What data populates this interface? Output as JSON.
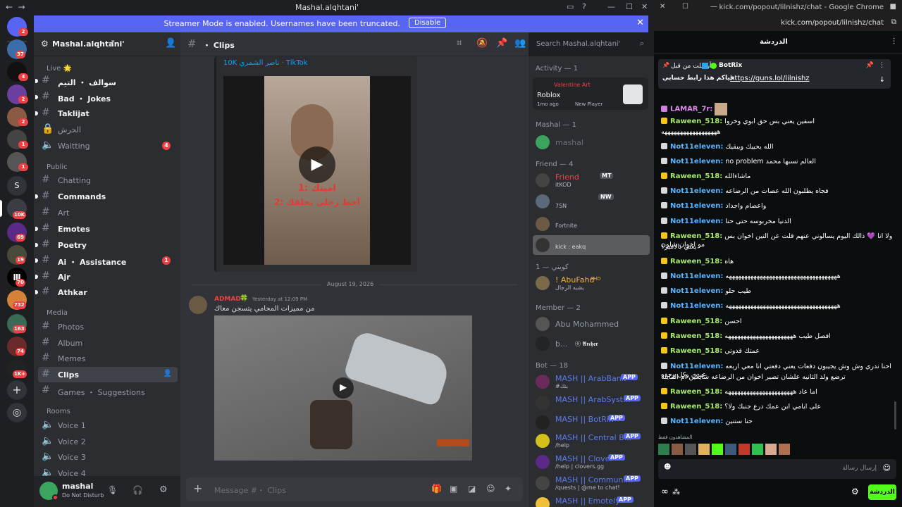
{
  "titlebar": {
    "title": "Mashal.alqhtani'"
  },
  "banner": {
    "message": "Streamer Mode is enabled. Usernames have been truncated.",
    "disable_label": "Disable"
  },
  "servers": [
    {
      "badge": "2"
    },
    {
      "badge": "37"
    },
    {
      "badge": "4"
    },
    {
      "badge": "2"
    },
    {
      "badge": "2"
    },
    {
      "badge": "1"
    },
    {
      "badge": "1"
    },
    {
      "letter": "S",
      "badge": ""
    },
    {
      "badge": "10K"
    },
    {
      "badge": "69"
    },
    {
      "badge": "19"
    },
    {
      "badge": "70"
    },
    {
      "badge": "732"
    },
    {
      "badge": "163"
    },
    {
      "badge": "74"
    },
    {
      "badge": "1K+"
    }
  ],
  "guild": {
    "name": "Mashal.alqhtani'"
  },
  "categories": {
    "live": "Live 🌟",
    "public": "Public",
    "media": "Media",
    "rooms": "Rooms"
  },
  "channels": [
    {
      "label": "سوالف ・ التيم"
    },
    {
      "label": "Bad ・ Jokes"
    },
    {
      "label": "Taklijat"
    },
    {
      "label": "الحرش"
    },
    {
      "label": "Waitting",
      "badge": "4"
    },
    {
      "label": "Chatting"
    },
    {
      "label": "Commands"
    },
    {
      "label": "Art"
    },
    {
      "label": "Emotes"
    },
    {
      "label": "Poetry"
    },
    {
      "label": "Ai ・ Assistance",
      "badge": "1"
    },
    {
      "label": "Ajr"
    },
    {
      "label": "Athkar"
    },
    {
      "label": "Photos"
    },
    {
      "label": "Album"
    },
    {
      "label": "Memes"
    },
    {
      "label": "Clips"
    },
    {
      "label": "Games ・ Suggestions"
    },
    {
      "label": "Voice 1"
    },
    {
      "label": "Voice 2"
    },
    {
      "label": "Voice 3"
    },
    {
      "label": "Voice 4"
    }
  ],
  "user": {
    "name": "mashal",
    "status": "Do Not Disturb"
  },
  "chat": {
    "channel": "・ Clips",
    "embed_link": "10K ناصر الشمري · TikTok",
    "video_caption_1": "1: اميتك",
    "video_caption_2": "2: أحط رجلي بحلقك",
    "date_divider": "August 19, 2026",
    "msg_author": "ADMAD",
    "msg_time": "Yesterday at 12:09 PM",
    "msg_text": "من مميزات المحامي يتسجن معاك",
    "input_placeholder": "Message #・ Clips"
  },
  "search": {
    "placeholder": "Search Mashal.alqhtani'"
  },
  "members": {
    "activity_head": "Activity — 1",
    "activity_user": "Valentine Art",
    "activity_game": "Roblox",
    "activity_time": "1mo ago",
    "activity_player": "New Player",
    "mashal_head": "Mashal — 1",
    "mashal_name": "mashal",
    "friend_head": "Friend — 4",
    "f1_name": "Friend",
    "f1_tag": "MT",
    "f1_status": "itKOD",
    "f2_tag": "NW",
    "f2_status": "7SN",
    "f3_status": "Fortnite",
    "f4_status": "kick : eakq",
    "k_head": "كويتي — 1",
    "k_name": "! AbuFahd",
    "k_tag": "FHD",
    "k_status": "يشبه الرجال",
    "member_head": "Member — 2",
    "m1_name": "Abu Mohammed",
    "m2_name": "b...",
    "m2_tag": "ⓞ 𝕬𝖗𝖈𝖍𝖊𝖗",
    "bot_head": "Bot — 18",
    "bots": [
      {
        "name": "MASH || ArabBank",
        "status": "#بنك"
      },
      {
        "name": "MASH || ArabSyst...",
        "status": ""
      },
      {
        "name": "MASH || BotRix",
        "status": ""
      },
      {
        "name": "MASH || Central B...",
        "status": "/help"
      },
      {
        "name": "MASH || Clover",
        "status": "/help | clovers.gg"
      },
      {
        "name": "MASH || Communi...",
        "status": "/quests | @me to chat!"
      },
      {
        "name": "MASH || Emotely",
        "status": ""
      }
    ],
    "app_label": "APP"
  },
  "kick": {
    "window_title": "kick.com/popout/lilnishz/chat - Google Chrome",
    "address": "kick.com/popout/lilnishz/chat",
    "header": "الدردشة",
    "pinned_by": "أرسلت من قبل",
    "pinned_user": "BotRix",
    "pinned_text": "حياكم هذا رابط حسابي",
    "pinned_link": "https://guns.lol/lilnishz",
    "messages": [
      {
        "user": "LAMAR_7r:",
        "text": ""
      },
      {
        "user": "Raween_518:",
        "text": "اسفين يعني بس حق ابوي وخروا"
      },
      {
        "user": "",
        "text": "ههههههههههههههههههه"
      },
      {
        "user": "Not11eleven:",
        "text": "الله يحييك ويبقيك"
      },
      {
        "user": "Not11eleven:",
        "text": "no problem العالم نسبها محمد"
      },
      {
        "user": "Raween_518:",
        "text": "ماشاءالله"
      },
      {
        "user": "Not11eleven:",
        "text": "فجاه يطلبون الله عصات من الرضاعه"
      },
      {
        "user": "Not11eleven:",
        "text": "واعصام واجداد"
      },
      {
        "user": "Not11eleven:",
        "text": "الدنيا مخربوسه حتى حنا"
      },
      {
        "user": "Raween_518:",
        "text": "ولا انا 💜 ذالك اليوم يسالوني عنهم قلت عن التين اخوان بس مو اخوان شلون"
      },
      {
        "user": "",
        "text": "يعني بالامير؟"
      },
      {
        "user": "Raween_518:",
        "text": "هاه"
      },
      {
        "user": "Not11eleven:",
        "text": "ههههههههههههههههههههههههههههههههههههه"
      },
      {
        "user": "Not11eleven:",
        "text": "طيب حلو"
      },
      {
        "user": "Not11eleven:",
        "text": "ههههههههههههههههههههههههههههههههههههه"
      },
      {
        "user": "Raween_518:",
        "text": "احسن"
      },
      {
        "user": "Raween_518:",
        "text": "افصل طيب ههههههههههههههههههههههه"
      },
      {
        "user": "Raween_518:",
        "text": "عمتك قدوتي"
      },
      {
        "user": "Not11eleven:",
        "text": "احنا ندري وش وش يجيبون دفعات يعني دفعتي انا معي اربعه عيري وكل وحده"
      },
      {
        "user": "",
        "text": "ترضع ولد الثانيه علشان تصير اخوان من الرضاعه شايكين ام المايلة"
      },
      {
        "user": "Raween_518:",
        "text": "اما عاد ههههههههههههههههههههههه"
      },
      {
        "user": "Raween_518:",
        "text": "على ايامي ابن عمك درع جنبك ولا؟"
      },
      {
        "user": "Not11eleven:",
        "text": "حنا ستنين"
      }
    ],
    "viewers_label": "المشاهدون فقط",
    "input_placeholder": "إرسال رسالة",
    "chat_button": "الدردشة"
  }
}
